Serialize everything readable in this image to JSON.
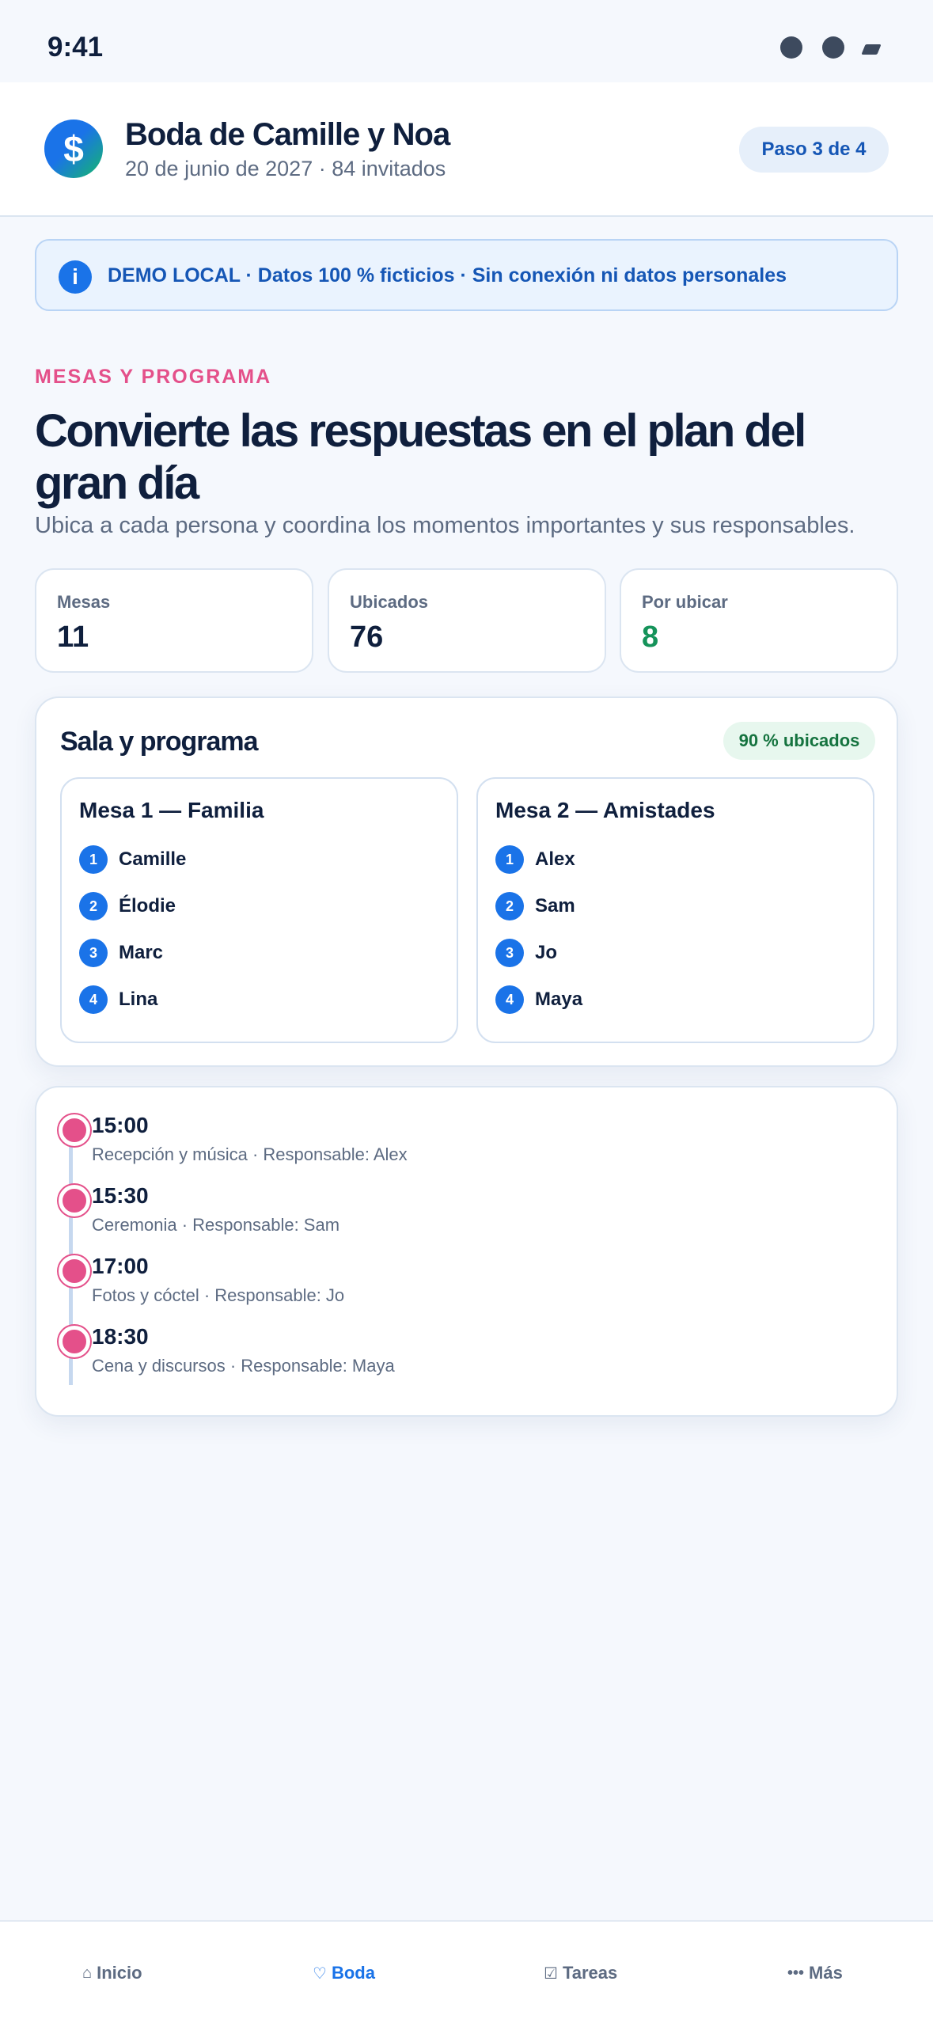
{
  "status_bar": {
    "time": "9:41"
  },
  "header": {
    "logo_glyph": "$",
    "title": "Boda de Camille y Noa",
    "subtitle": "20 de junio de 2027 · 84 invitados",
    "step": "Paso 3 de 4"
  },
  "banner": {
    "icon": "info-icon",
    "icon_glyph": "i",
    "text": "DEMO LOCAL · Datos 100 % ficticios · Sin conexión ni datos personales"
  },
  "section": {
    "kicker": "MESAS Y PROGRAMA",
    "title": "Convierte las respuestas en el plan del gran día",
    "description": "Ubica a cada persona y coordina los momentos importantes y sus responsables."
  },
  "stats": [
    {
      "label": "Mesas",
      "value": "11"
    },
    {
      "label": "Ubicados",
      "value": "76"
    },
    {
      "label": "Por ubicar",
      "value": "8"
    }
  ],
  "seating": {
    "title": "Sala y programa",
    "badge": "90 % ubicados",
    "tables": [
      {
        "name": "Mesa 1 — Familia",
        "guests": [
          {
            "num": "1",
            "name": "Camille"
          },
          {
            "num": "2",
            "name": "Élodie"
          },
          {
            "num": "3",
            "name": "Marc"
          },
          {
            "num": "4",
            "name": "Lina"
          }
        ]
      },
      {
        "name": "Mesa 2 — Amistades",
        "guests": [
          {
            "num": "1",
            "name": "Alex"
          },
          {
            "num": "2",
            "name": "Sam"
          },
          {
            "num": "3",
            "name": "Jo"
          },
          {
            "num": "4",
            "name": "Maya"
          }
        ]
      }
    ]
  },
  "timeline": [
    {
      "time": "15:00",
      "desc": "Recepción y música · Responsable: Alex"
    },
    {
      "time": "15:30",
      "desc": "Ceremonia · Responsable: Sam"
    },
    {
      "time": "17:00",
      "desc": "Fotos y cóctel · Responsable: Jo"
    },
    {
      "time": "18:30",
      "desc": "Cena y discursos · Responsable: Maya"
    }
  ],
  "nav": [
    {
      "label": "Inicio",
      "icon": "home-icon",
      "glyph": "⌂"
    },
    {
      "label": "Boda",
      "icon": "heart-icon",
      "glyph": "♡"
    },
    {
      "label": "Tareas",
      "icon": "checkbox-icon",
      "glyph": "☑"
    },
    {
      "label": "Más",
      "icon": "more-icon",
      "glyph": "•••"
    }
  ],
  "colors": {
    "accent": "#1a73e8",
    "kicker": "#e4508a",
    "success": "#15935a",
    "background": "#f5f8fd"
  }
}
